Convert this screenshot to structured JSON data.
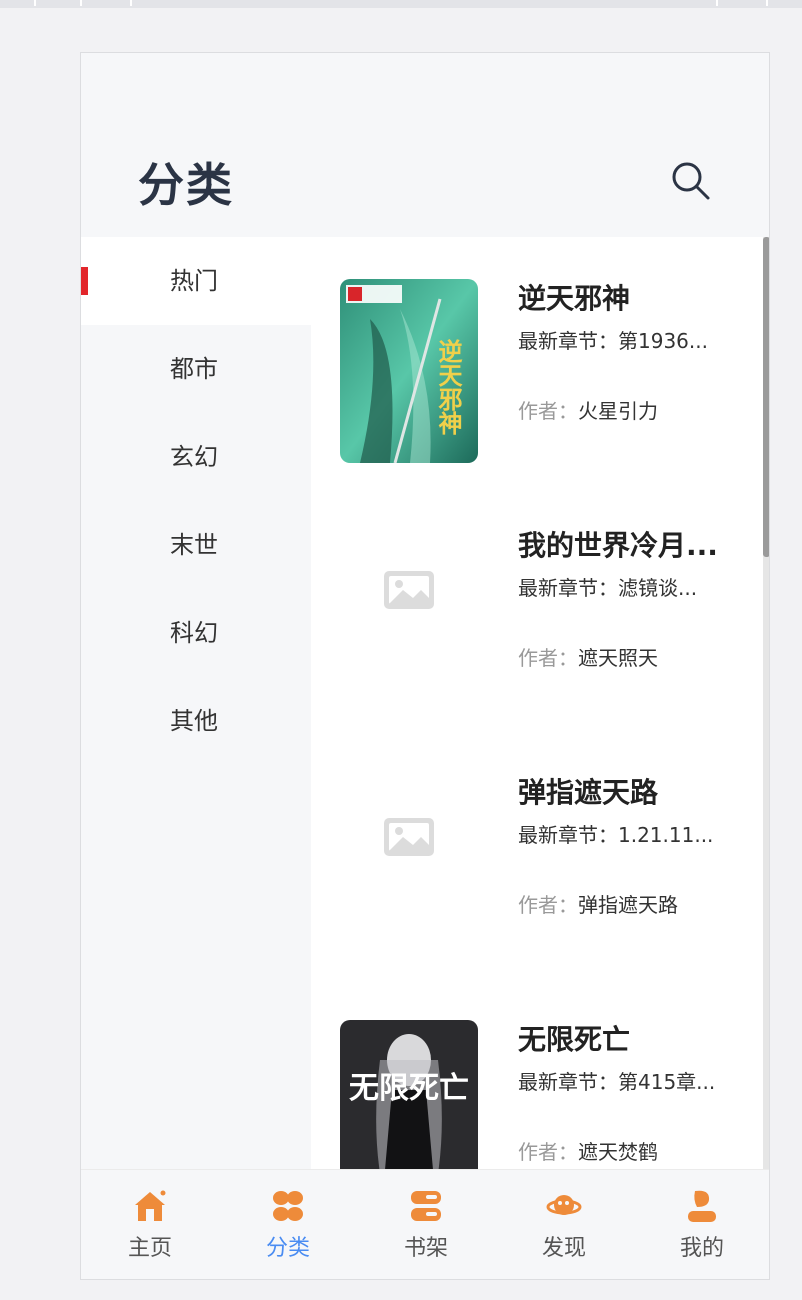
{
  "header": {
    "title": "分类"
  },
  "categories": [
    {
      "label": "热门",
      "active": true
    },
    {
      "label": "都市",
      "active": false
    },
    {
      "label": "玄幻",
      "active": false
    },
    {
      "label": "末世",
      "active": false
    },
    {
      "label": "科幻",
      "active": false
    },
    {
      "label": "其他",
      "active": false
    }
  ],
  "books": [
    {
      "title": "逆天邪神",
      "latest": "最新章节：第1936...",
      "author_label": "作者：",
      "author": "火星引力",
      "cover": "image",
      "cover_text": "逆天邪神"
    },
    {
      "title": "我的世界冷月...",
      "latest": "最新章节：滤镜谈...",
      "author_label": "作者：",
      "author": "遮天照天",
      "cover": "placeholder"
    },
    {
      "title": "弹指遮天路",
      "latest": "最新章节：1.21.11...",
      "author_label": "作者：",
      "author": "弹指遮天路",
      "cover": "placeholder"
    },
    {
      "title": "无限死亡",
      "latest": "最新章节：第415章...",
      "author_label": "作者：",
      "author": "遮天焚鹤",
      "cover": "image",
      "cover_text": "无限死亡"
    }
  ],
  "tabs": [
    {
      "label": "主页",
      "icon": "home-icon",
      "active": false
    },
    {
      "label": "分类",
      "icon": "category-icon",
      "active": true
    },
    {
      "label": "书架",
      "icon": "bookshelf-icon",
      "active": false
    },
    {
      "label": "发现",
      "icon": "discover-icon",
      "active": false
    },
    {
      "label": "我的",
      "icon": "profile-icon",
      "active": false
    }
  ],
  "colors": {
    "accent": "#4a8cf2",
    "active_marker": "#e2262b",
    "icon_orange": "#ee8b3a"
  }
}
